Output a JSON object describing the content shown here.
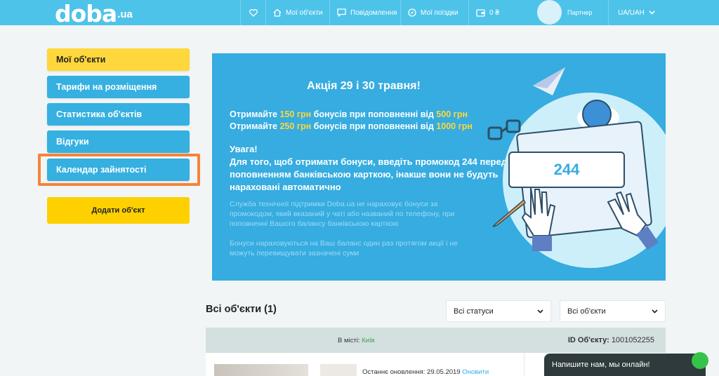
{
  "header": {
    "logo_main": "doba",
    "logo_tld": ".ua",
    "nav": {
      "favorites_icon": "heart-icon",
      "my_objects": "Мої об'єкти",
      "messages": "Повідомлення",
      "my_trips": "Мої поїздки",
      "balance": "0 ₴",
      "partner": "Партнер",
      "currency": "UA/UAH"
    }
  },
  "sidebar": {
    "items": [
      {
        "label": "Мої об'єкти",
        "active": true
      },
      {
        "label": "Тарифи на розміщення",
        "active": false
      },
      {
        "label": "Статистика об'єктів",
        "active": false
      },
      {
        "label": "Відгуки",
        "active": false
      },
      {
        "label": "Календар зайнятості",
        "active": false
      }
    ],
    "add_button": "Додати об'єкт"
  },
  "banner": {
    "title": "Акція 29 і 30 травня!",
    "offer1": {
      "pre": "Отримайте ",
      "bonus": "150 грн",
      "mid": " бонусів при поповненні від ",
      "amount": "500 грн"
    },
    "offer2": {
      "pre": "Отримайте ",
      "bonus": "250 грн",
      "mid": " бонусів при поповненні від ",
      "amount": "1000 грн"
    },
    "warning_title": "Увага!",
    "warning_text": "Для того, щоб отримати бонуси, введіть промокод 244 перед поповненням банківською карткою, інакше вони не будуть нараховані автоматично",
    "note1": "Служба технічної підтримки Doba.ua не нараховує бонуси за промокодом, який вказаний у чаті або названий по телефону, при поповненні Вашого балансу банківською карткою",
    "note2": "Бонуси нараховуються на Ваш баланс один раз протягом акції і не можуть перевищувати зазначені суми",
    "promo_code": "244"
  },
  "objects": {
    "title": "Всі об'єкти (1)",
    "status_filter": "Всі статуси",
    "object_filter": "Всі об'єкти",
    "city_label": "В місті: ",
    "city_value": "Київ",
    "id_label": "ID Об'єкту: ",
    "id_value": "1001052255",
    "updated_text": "Останнє оновлення: 29.05.2019 ",
    "update_link": "Оновити"
  },
  "chat": {
    "label": "Напишите нам, мы онлайн!"
  },
  "colors": {
    "topbar": "#4ec3ea",
    "sidebar_button": "#35b0e0",
    "sidebar_active": "#fed73c",
    "banner": "#36ace0",
    "highlight": "#f5833a"
  }
}
